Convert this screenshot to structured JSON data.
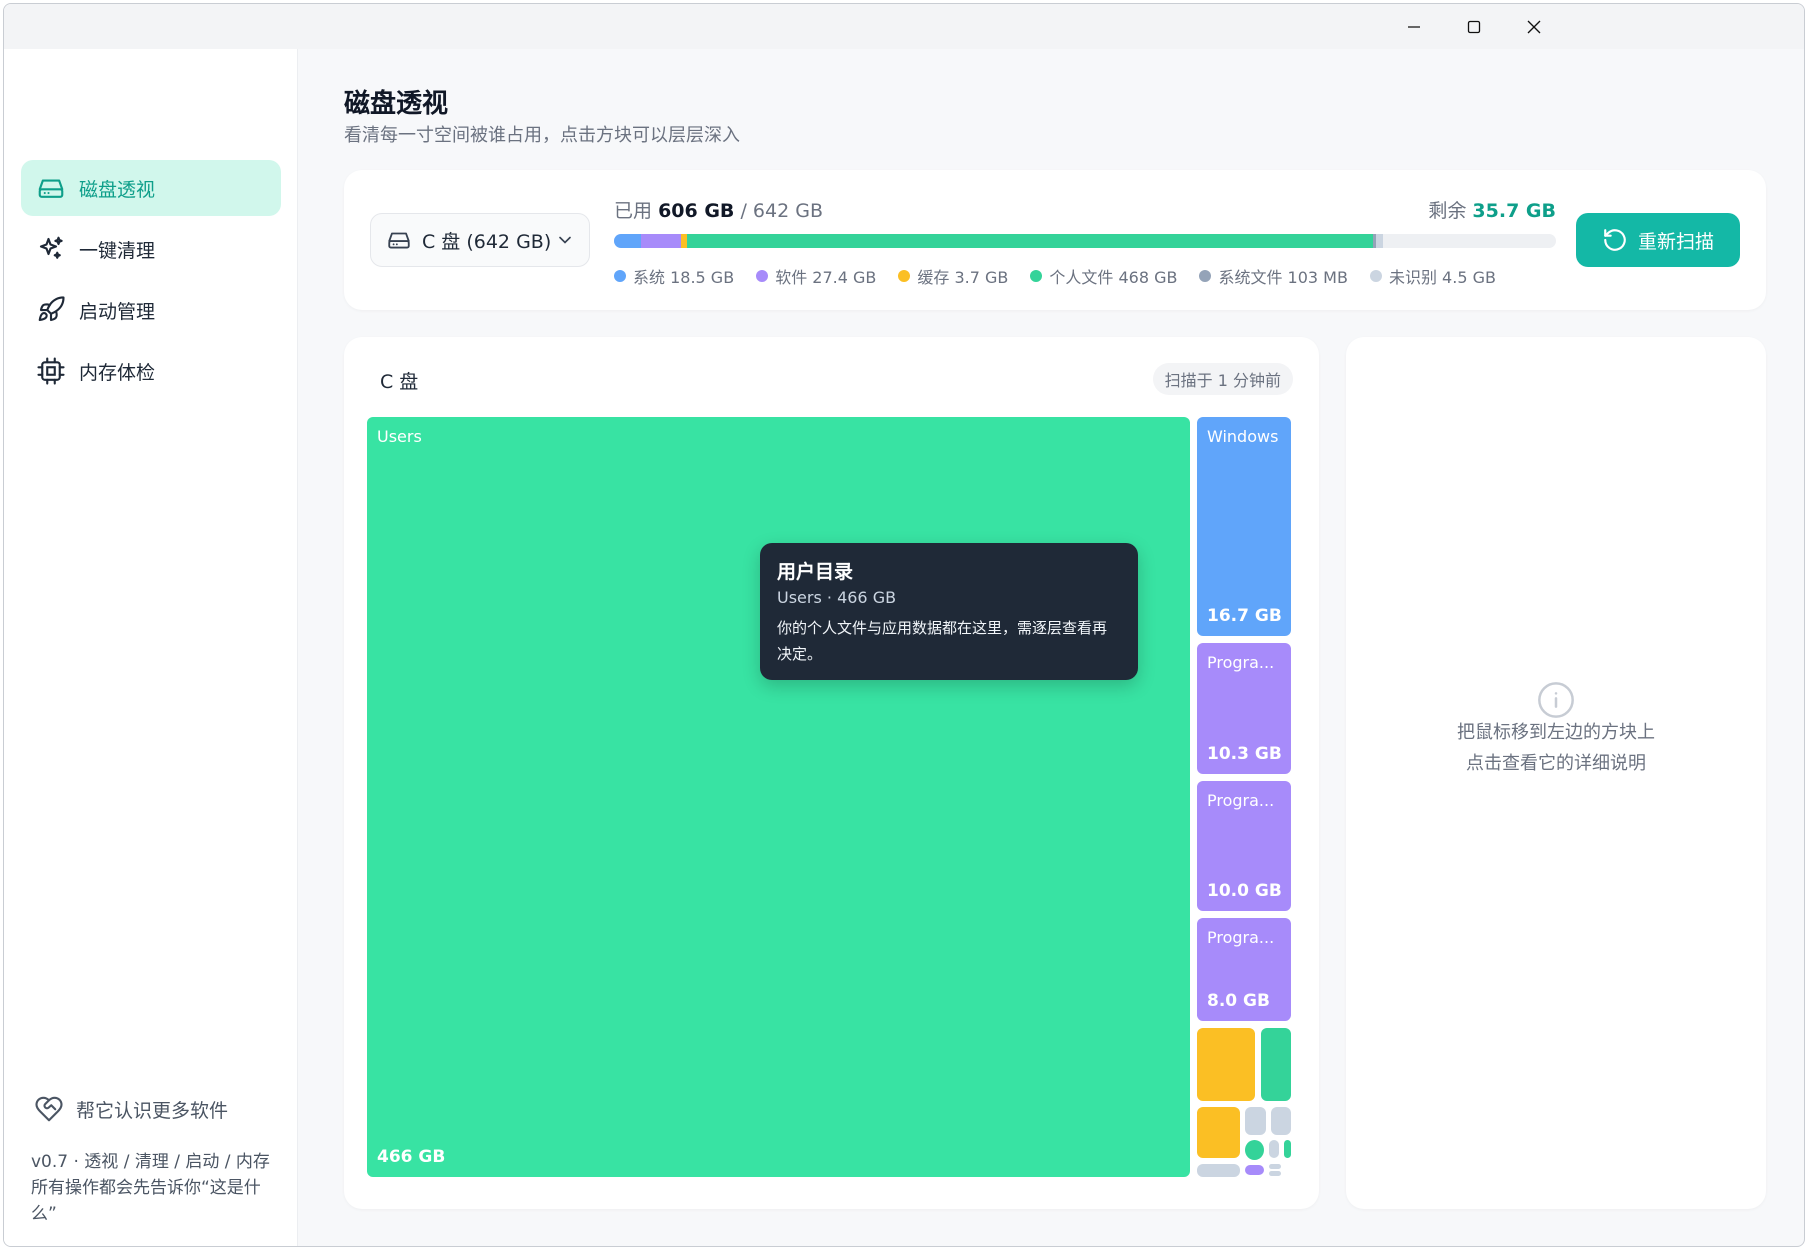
{
  "window": {
    "controls": [
      "minimize",
      "maximize",
      "close"
    ]
  },
  "sidebar": {
    "items": [
      {
        "label": "磁盘透视",
        "icon": "hard-drive-icon",
        "active": true
      },
      {
        "label": "一键清理",
        "icon": "sparkles-icon",
        "active": false
      },
      {
        "label": "启动管理",
        "icon": "rocket-icon",
        "active": false
      },
      {
        "label": "内存体检",
        "icon": "cpu-chip-icon",
        "active": false
      }
    ],
    "help_label": "帮它认识更多软件",
    "version_line1": "v0.7 · 透视 / 清理 / 启动 / 内存",
    "version_line2": "所有操作都会先告诉你“这是什么”"
  },
  "header": {
    "title": "磁盘透视",
    "subtitle": "看清每一寸空间被谁占用，点击方块可以层层深入"
  },
  "summary": {
    "drive_label": "C 盘 (642 GB)",
    "used_prefix": "已用",
    "used_value": "606 GB",
    "total_value": "/ 642 GB",
    "free_prefix": "剩余",
    "free_value": "35.7 GB",
    "rescan_label": "重新扫描",
    "segments": [
      {
        "label": "系统 18.5 GB",
        "value": 18.5,
        "color": "#60a5fa"
      },
      {
        "label": "软件 27.4 GB",
        "value": 27.4,
        "color": "#a78bfa"
      },
      {
        "label": "缓存 3.7 GB",
        "value": 3.7,
        "color": "#fbbf24"
      },
      {
        "label": "个人文件 468 GB",
        "value": 468,
        "color": "#34d399"
      },
      {
        "label": "系统文件 103 MB",
        "value": 0.103,
        "color": "#94a3b8"
      },
      {
        "label": "未识别 4.5 GB",
        "value": 4.5,
        "color": "#cbd5e1"
      }
    ]
  },
  "treemap": {
    "drive_title": "C 盘",
    "scan_time": "扫描于 1 分钟前",
    "tiles": [
      {
        "name": "Users",
        "size": "466 GB",
        "color": "#38e3a3"
      },
      {
        "name": "Windows",
        "size": "16.7 GB",
        "color": "#60a5fa"
      },
      {
        "name": "Progra...",
        "size": "10.3 GB",
        "color": "#a78bfa"
      },
      {
        "name": "Progra...",
        "size": "10.0 GB",
        "color": "#a78bfa"
      },
      {
        "name": "Progra...",
        "size": "8.0 GB",
        "color": "#a78bfa"
      }
    ]
  },
  "tooltip": {
    "title": "用户目录",
    "meta": "Users · 466 GB",
    "desc": "你的个人文件与应用数据都在这里，需逐层查看再决定。"
  },
  "detail": {
    "hint_line1": "把鼠标移到左边的方块上",
    "hint_line2": "点击查看它的详细说明"
  },
  "colors": {
    "accent": "#14b8a6",
    "accent_text": "#0e9f8a",
    "active_bg": "#d1f7ec"
  }
}
